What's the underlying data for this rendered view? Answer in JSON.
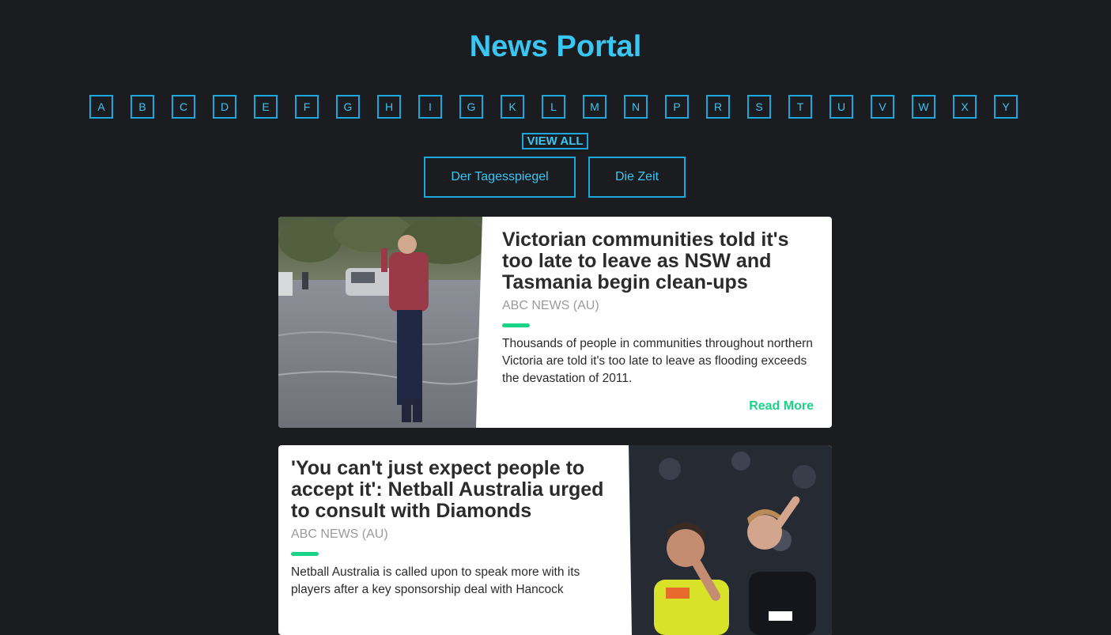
{
  "header": {
    "title": "News Portal"
  },
  "letters": [
    "A",
    "B",
    "C",
    "D",
    "E",
    "F",
    "G",
    "H",
    "I",
    "G",
    "K",
    "L",
    "M",
    "N",
    "P",
    "R",
    "S",
    "T",
    "U",
    "V",
    "W",
    "X",
    "Y"
  ],
  "view_all_label": "VIEW ALL",
  "sources": [
    "Der Tagesspiegel",
    "Die Zeit"
  ],
  "articles": [
    {
      "title": "Victorian communities told it's too late to leave as NSW and Tasmania begin clean-ups",
      "source": "ABC NEWS (AU)",
      "description": "Thousands of people in communities throughout northern Victoria are told it's too late to leave as flooding exceeds the devastation of 2011.",
      "read_more": "Read More",
      "image": "flood-photo"
    },
    {
      "title": "'You can't just expect people to accept it': Netball Australia urged to consult with Diamonds",
      "source": "ABC NEWS (AU)",
      "description": "Netball Australia is called upon to speak more with its players after a key sponsorship deal with Hancock",
      "image": "netball-photo"
    }
  ],
  "colors": {
    "accent": "#39c6f2",
    "border": "#1ba7dd",
    "green": "#19d387",
    "background": "#1b1c20"
  }
}
